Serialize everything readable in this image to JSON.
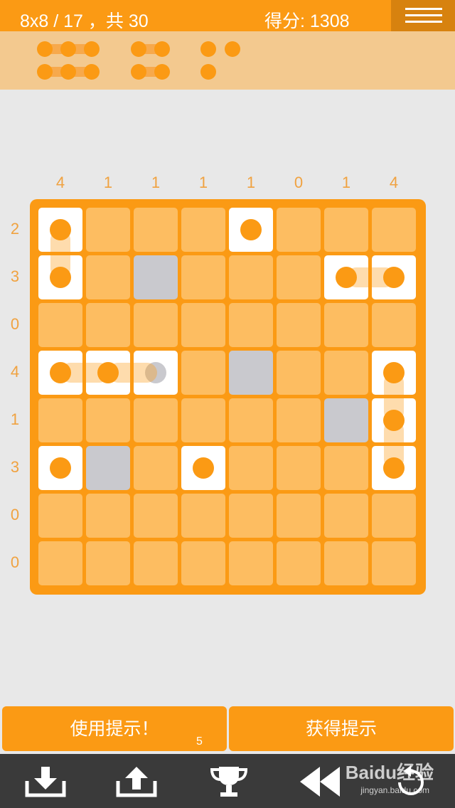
{
  "header": {
    "level_text": "8x8 / 17  ，共 30",
    "score_text": "得分: 1308"
  },
  "fleet": [
    {
      "size": 3,
      "sunk": true
    },
    {
      "size": 2,
      "sunk": true
    },
    {
      "size": 1,
      "sunk": true
    },
    {
      "size": 1,
      "sunk": true
    },
    {
      "size": 3,
      "sunk": true
    },
    {
      "size": 2,
      "sunk": true
    },
    {
      "size": 1,
      "sunk": true
    }
  ],
  "column_clues": [
    "4",
    "1",
    "1",
    "1",
    "1",
    "0",
    "1",
    "4"
  ],
  "row_clues": [
    "2",
    "3",
    "0",
    "4",
    "1",
    "3",
    "0",
    "0"
  ],
  "grid": [
    [
      "ship-top",
      "empty",
      "empty",
      "empty",
      "ship-single",
      "empty",
      "empty",
      "empty"
    ],
    [
      "ship-bottom",
      "empty",
      "water",
      "empty",
      "empty",
      "empty",
      "ship-left",
      "ship-right"
    ],
    [
      "empty",
      "empty",
      "empty",
      "empty",
      "empty",
      "empty",
      "empty",
      "empty"
    ],
    [
      "ship-left",
      "ship-middle",
      "ship-right-gray",
      "empty",
      "water",
      "empty",
      "empty",
      "ship-top"
    ],
    [
      "empty",
      "empty",
      "empty",
      "empty",
      "empty",
      "empty",
      "water",
      "ship-middle"
    ],
    [
      "ship-single",
      "water",
      "empty",
      "ship-single",
      "empty",
      "empty",
      "empty",
      "ship-bottom"
    ],
    [
      "empty",
      "empty",
      "empty",
      "empty",
      "empty",
      "empty",
      "empty",
      "empty"
    ],
    [
      "empty",
      "empty",
      "empty",
      "empty",
      "empty",
      "empty",
      "empty",
      "empty"
    ]
  ],
  "buttons": {
    "use_hint": "使用提示！",
    "hint_count": "5",
    "get_hint": "获得提示"
  },
  "toolbar": [
    "download-icon",
    "share-icon",
    "trophy-icon",
    "rewind-icon",
    "undo-icon"
  ],
  "watermark": {
    "brand": "Baidu经验",
    "url": "jingyan.baidu.com"
  },
  "colors": {
    "accent": "#fb9a14",
    "cell": "#fdbd61",
    "water": "#c9c9ce",
    "toolbar": "#3a3a3a"
  }
}
